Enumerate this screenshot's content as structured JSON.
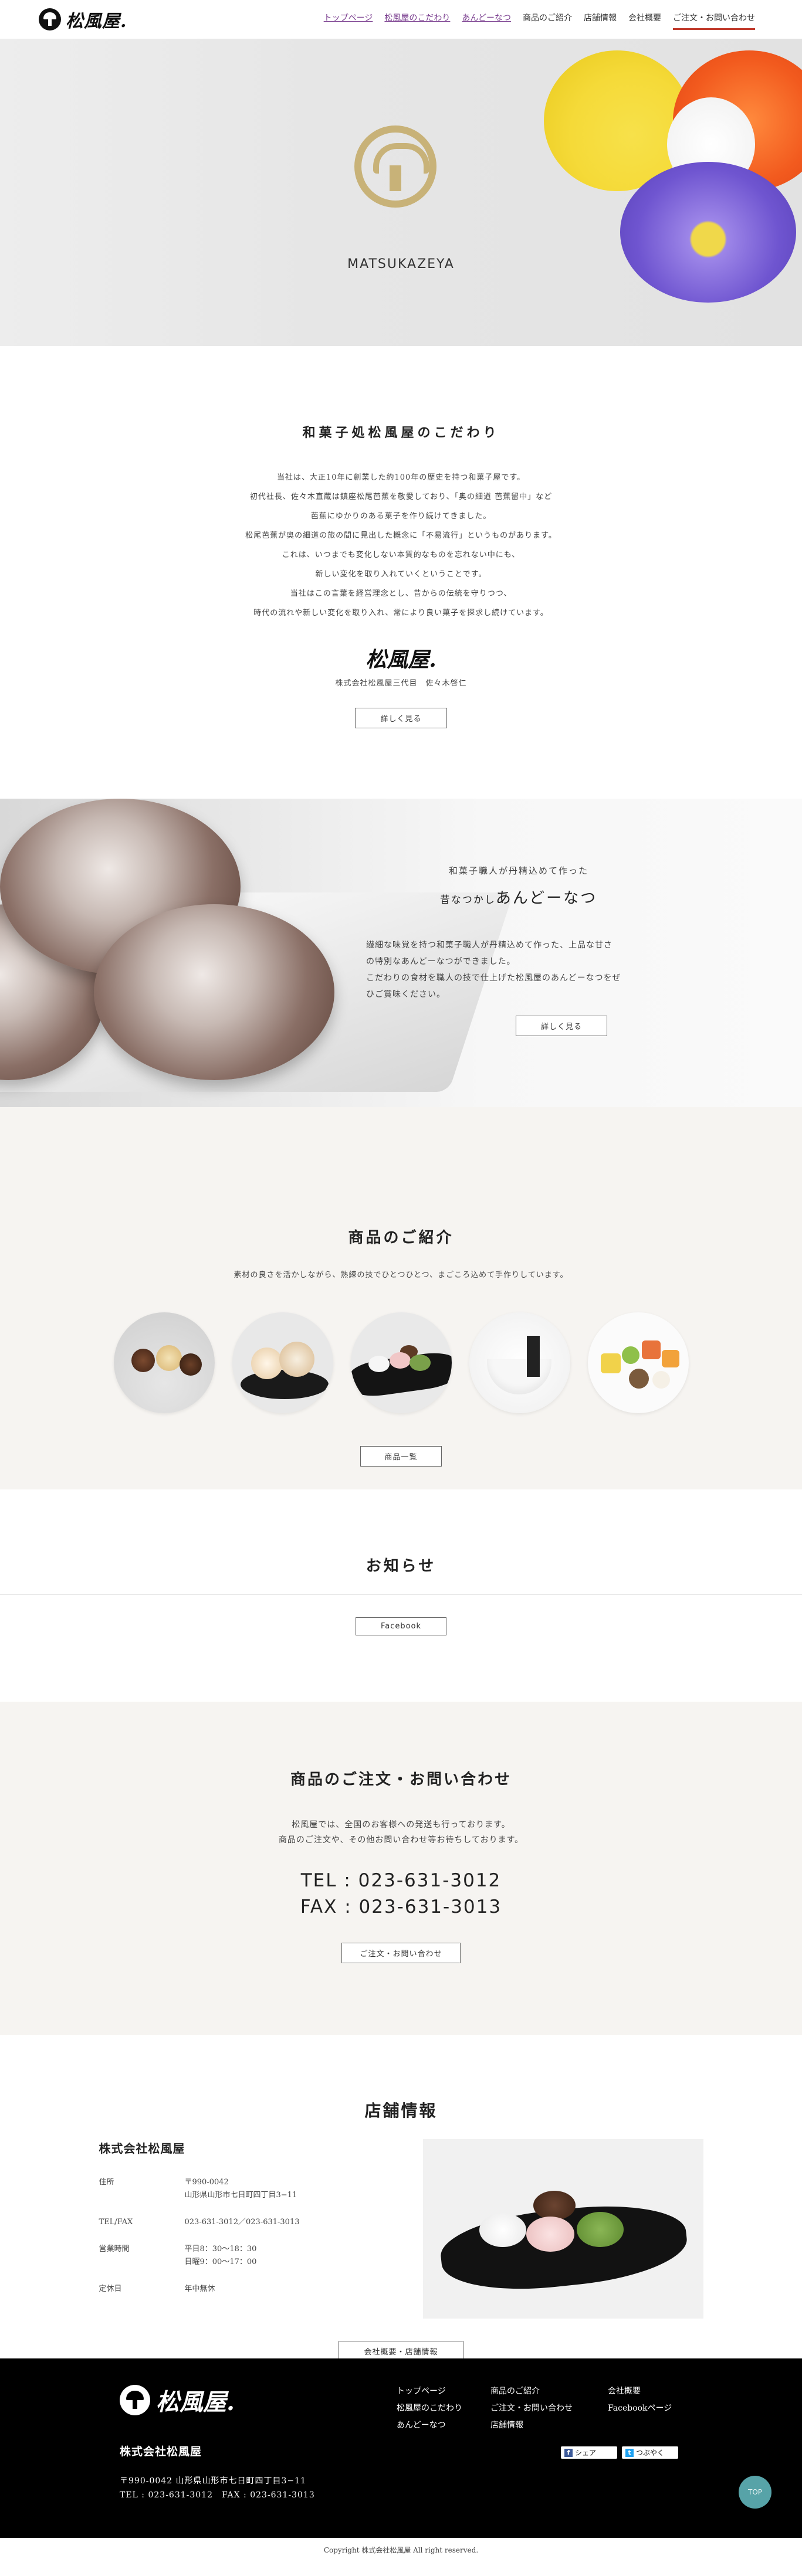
{
  "header": {
    "logo_text": "松風屋.",
    "nav": [
      {
        "label": "トップページ"
      },
      {
        "label": "松風屋のこだわり"
      },
      {
        "label": "あんどーなつ"
      },
      {
        "label": "商品のご紹介"
      },
      {
        "label": "店舗情報"
      },
      {
        "label": "会社概要"
      },
      {
        "label": "ご注文・お問い合わせ"
      }
    ]
  },
  "hero": {
    "brand": "MATSUKAZEYA"
  },
  "kodawari": {
    "title": "和菓子処松風屋のこだわり",
    "lines": [
      "当社は、大正10年に創業した約100年の歴史を持つ和菓子屋です。",
      "初代社長、佐々木直蔵は鎮座松尾芭蕉を敬愛しており、「奥の細道 芭蕉留中」など",
      "芭蕉にゆかりのある菓子を作り続けてきました。",
      "松尾芭蕉が奥の細道の旅の間に見出した概念に「不易流行」というものがあります。",
      "これは、いつまでも変化しない本質的なものを忘れない中にも、",
      "新しい変化を取り入れていくということです。",
      "当社はこの言葉を経営理念とし、昔からの伝統を守りつつ、",
      "時代の流れや新しい変化を取り入れ、常により良い菓子を探求し続けています。"
    ],
    "signature": "松風屋.",
    "signature_sub": "株式会社松風屋三代目　佐々木啓仁",
    "button": "詳しく見る"
  },
  "andonut": {
    "sub": "和菓子職人が丹精込めて作った",
    "title_small": "昔なつかし",
    "title_big": "あんどーなつ",
    "desc": [
      "繊細な味覚を持つ和菓子職人が丹精込めて作った、上品な甘さ",
      "の特別なあんどーなつができました。",
      "こだわりの食材を職人の技で仕上げた松風屋のあんどーなつをぜ",
      "ひご賞味ください。"
    ],
    "button": "詳しく見る"
  },
  "products": {
    "title": "商品のご紹介",
    "lead": "素材の良さを活かしながら、熟練の技でひとつひとつ、まごころ込めて手作りしています。",
    "button": "商品一覧"
  },
  "news": {
    "title": "お知らせ",
    "button": "Facebook"
  },
  "contact": {
    "title": "商品のご注文・お問い合わせ",
    "lead": [
      "松風屋では、全国のお客様への発送も行っております。",
      "商品のご注文や、その他お問い合わせ等お待ちしております。"
    ],
    "tel": "TEL : 023-631-3012",
    "fax": "FAX : 023-631-3013",
    "button": "ご注文・お問い合わせ"
  },
  "shop": {
    "title": "店舗情報",
    "name": "株式会社松風屋",
    "rows": [
      {
        "key": "住所",
        "value1": "〒990-0042",
        "value2": "山形県山形市七日町四丁目3−11"
      },
      {
        "key": "TEL/FAX",
        "value1": "023-631-3012／023-631-3013",
        "value2": ""
      },
      {
        "key": "営業時間",
        "value1": "平日8：30〜18：30",
        "value2": "日曜9：00〜17：00"
      },
      {
        "key": "定休日",
        "value1": "年中無休",
        "value2": ""
      }
    ],
    "button": "会社概要・店舗情報"
  },
  "footer": {
    "logo_text": "松風屋.",
    "company": "株式会社松風屋",
    "addr1": "〒990-0042 山形県山形市七日町四丁目3−11",
    "addr2": "TEL : 023-631-3012　FAX : 023-631-3013",
    "nav_col1": [
      "トップページ",
      "松風屋のこだわり",
      "あんどーなつ"
    ],
    "nav_col2": [
      "商品のご紹介",
      "ご注文・お問い合わせ",
      "店舗情報"
    ],
    "nav_col3": [
      "会社概要",
      "Facebookページ"
    ],
    "share_label": "シェア",
    "tweet_label": "つぶやく",
    "page_top": "TOP",
    "copyright": "Copyright 株式会社松風屋 All right reserved."
  },
  "colors": {
    "accent_red": "#c0392b",
    "gold": "#c8b278",
    "link_purple": "#7a3e8f",
    "page_top": "#57a3a8"
  }
}
